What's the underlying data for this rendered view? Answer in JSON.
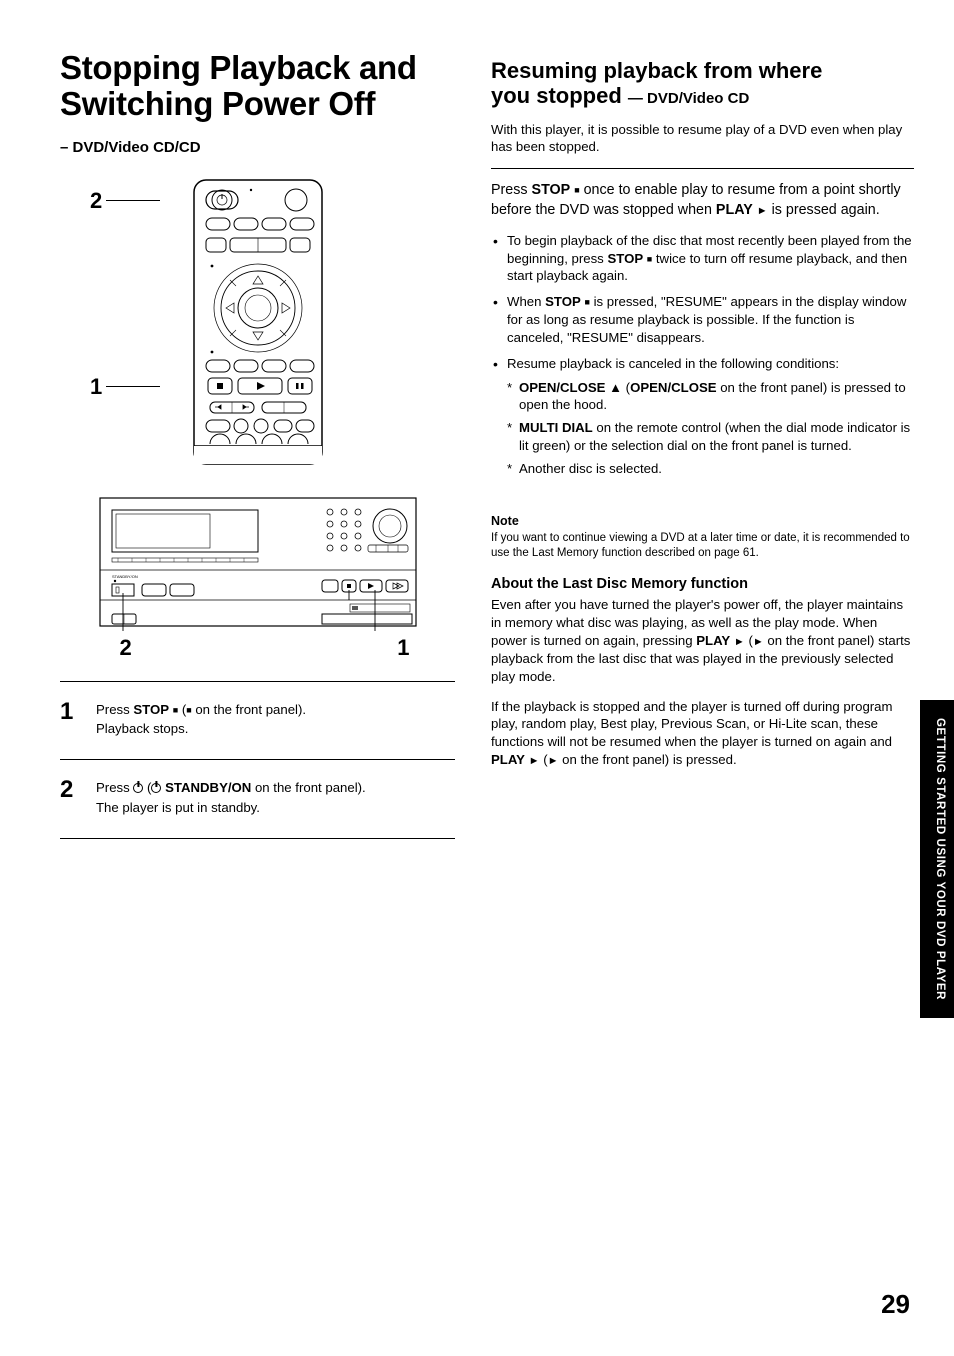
{
  "left": {
    "title_line1": "Stopping Playback and",
    "title_line2": "Switching Power Off",
    "subtitle": "– DVD/Video CD/CD",
    "callout_top": "2",
    "callout_bot": "1",
    "panel_left": "2",
    "panel_right": "1",
    "steps": [
      {
        "num": "1",
        "line1_a": "Press ",
        "line1_stop": "STOP",
        "line1_b": " (",
        "line1_c": " on the front panel).",
        "line2": "Playback stops."
      },
      {
        "num": "2",
        "line1_a": "Press ",
        "line1_b": " (",
        "line1_standby": " STANDBY/ON",
        "line1_c": " on the front panel).",
        "line2": "The player is put in standby."
      }
    ]
  },
  "right": {
    "heading_a": "Resuming playback from where",
    "heading_b": "you stopped ",
    "heading_tag": "— DVD/Video CD",
    "intro": "With this player, it is possible to resume play of a DVD even when play has been stopped.",
    "instr_a": "Press ",
    "instr_stop": "STOP",
    "instr_b": " once to enable play to resume from a point shortly before the DVD was stopped when ",
    "instr_play": "PLAY",
    "instr_c": " is pressed again.",
    "bullets": [
      {
        "a": "To begin playback of the disc that most recently been played from the beginning, press ",
        "stop": "STOP",
        "b": " twice to turn off resume playback, and then start playback again."
      },
      {
        "a": "When ",
        "stop": "STOP",
        "b": " is pressed, \"RESUME\" appears in the display window for as long as resume playback is possible. If the function is canceled, \"RESUME\" disappears."
      },
      {
        "a": "Resume playback is canceled in the following conditions:",
        "sub": [
          {
            "oc": "OPEN/CLOSE",
            "a": " (",
            "oc2": "OPEN/CLOSE",
            "b": " on the front panel) is pressed to open the hood."
          },
          {
            "md": "MULTI DIAL",
            "a": " on the remote control (when the dial mode indicator is lit green) or the selection dial on the front panel is turned."
          },
          {
            "plain": "Another disc is selected."
          }
        ]
      }
    ],
    "note_head": "Note",
    "note_text": "If you want to continue viewing a DVD at a later time or date, it is recommended to use the Last Memory function described on page 61.",
    "about_head": "About the Last Disc Memory function",
    "about_p1_a": "Even after you have turned the player's power off, the player maintains in memory what disc was playing, as well as the play mode. When power is turned on again, pressing ",
    "about_p1_play": "PLAY",
    "about_p1_b": " (",
    "about_p1_c": " on the front panel) starts playback from the last disc that was played in the previously selected play mode.",
    "about_p2_a": "If the playback is stopped and the player is turned off during program play, random play, Best play, Previous Scan, or Hi-Lite scan, these functions will not be resumed when the player is turned on again and ",
    "about_p2_play": "PLAY",
    "about_p2_b": " (",
    "about_p2_c": " on the front panel) is pressed."
  },
  "side_tab": "GETTING STARTED USING YOUR DVD PLAYER",
  "page_number": "29"
}
